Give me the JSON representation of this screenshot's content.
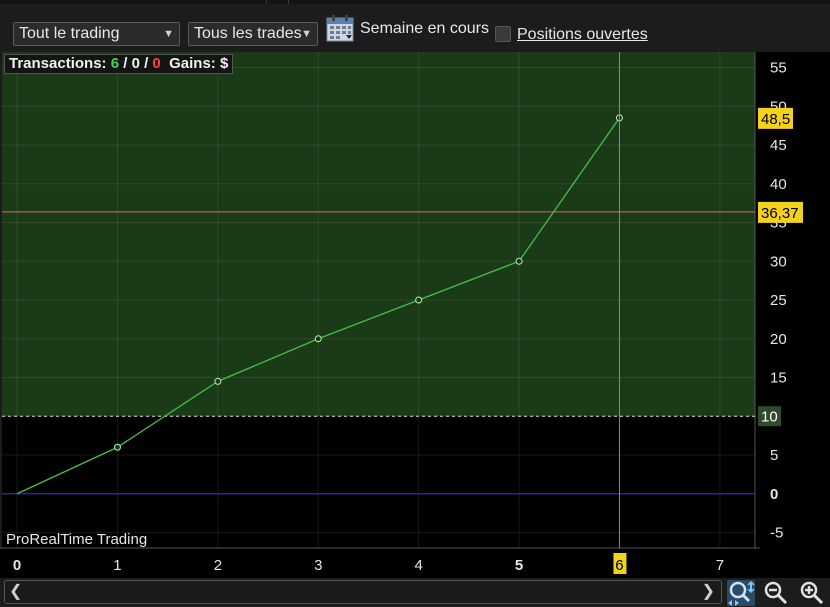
{
  "toolbar": {
    "trading_select": "Tout le trading",
    "trades_select": "Tous les trades",
    "week_label": "Semaine en cours",
    "open_positions_label": "Positions ouvertes",
    "open_positions_checked": false
  },
  "stats": {
    "transactions_label": "Transactions:",
    "count_winning": "6",
    "count_neutral": "0",
    "count_losing": "0",
    "gains_label": "Gains:",
    "currency": "$"
  },
  "watermark": "ProRealTime Trading",
  "colors": {
    "profit_zone": "#1a3a18",
    "loss_zone": "#000000",
    "line": "#44c044",
    "zero_line": "#2b2bbf",
    "crosshair": "#d4704a",
    "marker_bg": "#f2d21a"
  },
  "chart_data": {
    "type": "line",
    "x": [
      0,
      1,
      2,
      3,
      4,
      5,
      6
    ],
    "series": [
      {
        "values": [
          0,
          6,
          14.5,
          20,
          25,
          30,
          48.5
        ]
      }
    ],
    "xlim": [
      -0.15,
      7.35
    ],
    "ylim": [
      -7,
      57
    ],
    "x_ticks": [
      "0",
      "1",
      "2",
      "3",
      "4",
      "5",
      "6",
      "7"
    ],
    "y_ticks": [
      "55",
      "50",
      "45",
      "40",
      "35",
      "30",
      "25",
      "20",
      "15",
      "10",
      "5",
      "0",
      "-5"
    ],
    "threshold": 10,
    "threshold_label": "10",
    "last_value_label": "48,5",
    "crosshair_y": 36.37,
    "crosshair_y_label": "36,37",
    "crosshair_x": 6,
    "crosshair_x_label": "6",
    "grid": true
  }
}
